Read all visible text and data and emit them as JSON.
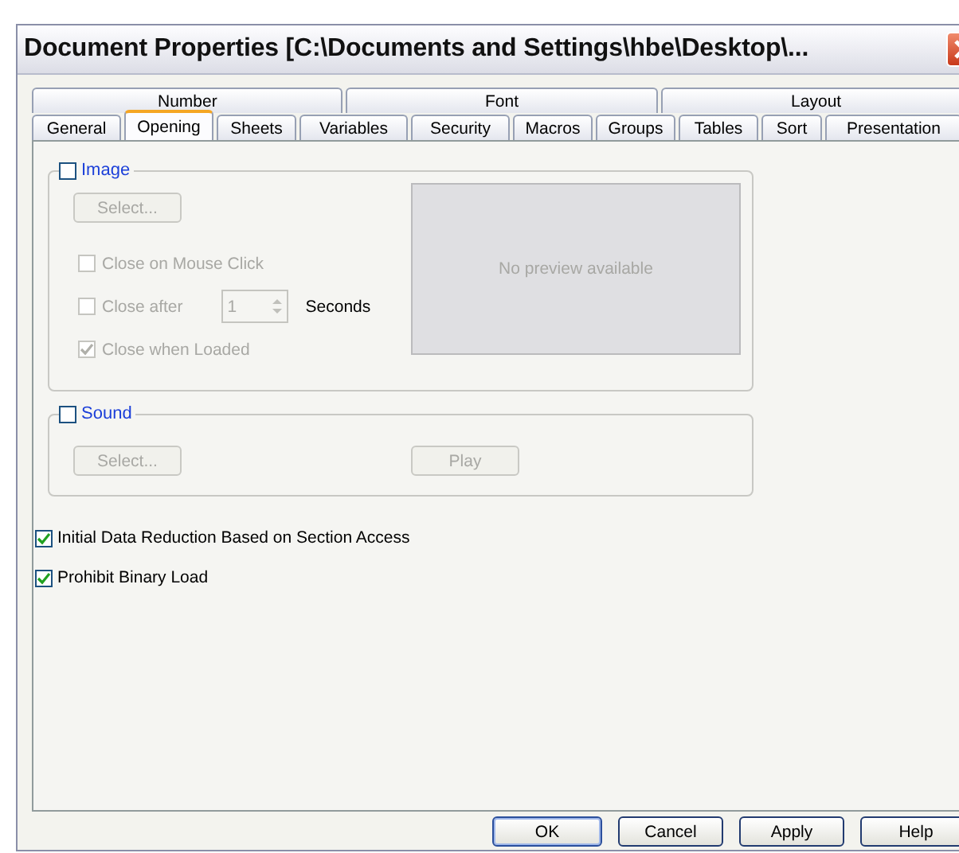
{
  "window": {
    "title": "Document Properties [C:\\Documents and Settings\\hbe\\Desktop\\..."
  },
  "tab_rows": [
    [
      {
        "label": "Number",
        "selected": false
      },
      {
        "label": "Font",
        "selected": false
      },
      {
        "label": "Layout",
        "selected": false
      }
    ],
    [
      {
        "label": "General",
        "selected": false
      },
      {
        "label": "Opening",
        "selected": true
      },
      {
        "label": "Sheets",
        "selected": false
      },
      {
        "label": "Variables",
        "selected": false
      },
      {
        "label": "Security",
        "selected": false
      },
      {
        "label": "Macros",
        "selected": false
      },
      {
        "label": "Groups",
        "selected": false
      },
      {
        "label": "Tables",
        "selected": false
      },
      {
        "label": "Sort",
        "selected": false
      },
      {
        "label": "Presentation",
        "selected": false
      }
    ]
  ],
  "image_group": {
    "label": "Image",
    "checked": false,
    "select_button": {
      "label": "Select...",
      "disabled": true
    },
    "options": [
      {
        "kind": "checkbox",
        "label": "Close on Mouse Click",
        "checked": false,
        "disabled": true
      },
      {
        "kind": "spinner",
        "label": "Close after",
        "checked": false,
        "disabled": true,
        "value": "1",
        "unit": "Seconds"
      },
      {
        "kind": "checkbox",
        "label": "Close when Loaded",
        "checked": true,
        "disabled": true
      }
    ],
    "preview_text": "No preview available"
  },
  "sound_group": {
    "label": "Sound",
    "checked": false,
    "select_button": {
      "label": "Select...",
      "disabled": true
    },
    "play_button": {
      "label": "Play",
      "disabled": true
    }
  },
  "options": [
    {
      "label": "Initial Data Reduction Based on Section Access",
      "checked": true
    },
    {
      "label": "Prohibit Binary Load",
      "checked": true
    }
  ],
  "buttons": [
    {
      "label": "OK",
      "default": true
    },
    {
      "label": "Cancel",
      "default": false
    },
    {
      "label": "Apply",
      "default": false
    },
    {
      "label": "Help",
      "default": false
    }
  ]
}
